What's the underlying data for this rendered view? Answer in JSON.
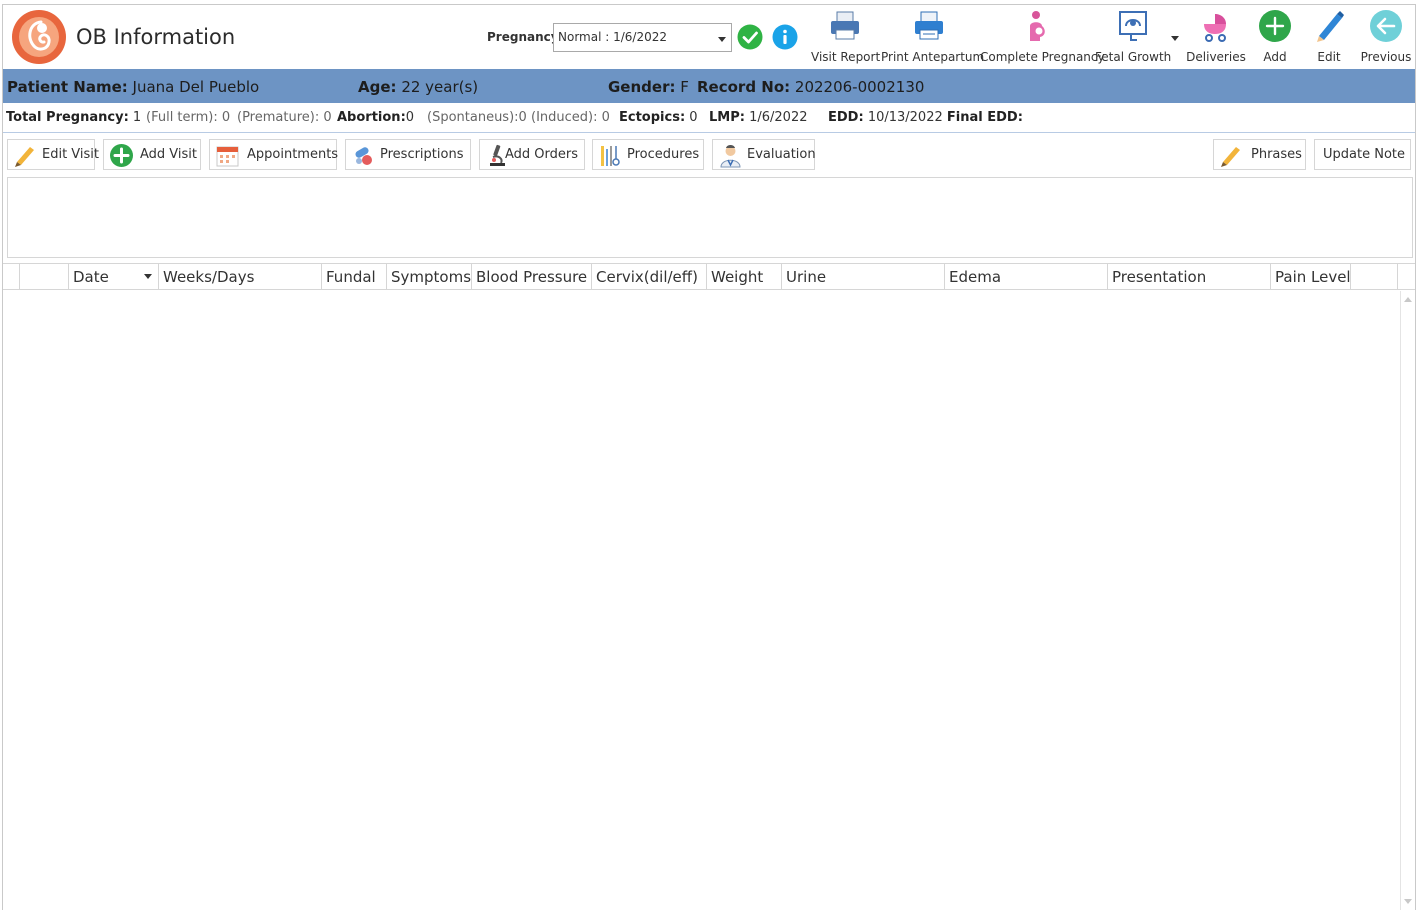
{
  "app": {
    "title": "OB Information",
    "logo_icon": "fetus-logo-icon"
  },
  "pregnancy": {
    "label": "Pregnancy:",
    "selected": "Normal : 1/6/2022"
  },
  "toolbar": {
    "visit_report": "Visit Report",
    "print_antepartum": "Print Antepartum",
    "complete_pregnancy": "Complete Pregnancy",
    "fetal_growth": "Fetal Growth",
    "deliveries": "Deliveries",
    "add": "Add",
    "edit": "Edit",
    "previous": "Previous"
  },
  "patient": {
    "name_label": "Patient Name:",
    "name": "Juana Del Pueblo",
    "age_label": "Age:",
    "age": "22 year(s)",
    "gender_label": "Gender:",
    "gender": "F",
    "record_label": "Record No:",
    "record": "202206-0002130"
  },
  "summary": {
    "total_label": "Total Pregnancy:",
    "total": "1",
    "fullterm_label": "(Full term):",
    "fullterm": "0",
    "premature_label": "(Premature):",
    "premature": "0",
    "abortion_label": "Abortion:",
    "abortion": "0",
    "spontaneus_label": "(Spontaneus):",
    "spontaneus": "0",
    "induced_label": "(Induced):",
    "induced": "0",
    "ectopics_label": "Ectopics:",
    "ectopics": "0",
    "lmp_label": "LMP:",
    "lmp": "1/6/2022",
    "edd_label": "EDD:",
    "edd": "10/13/2022",
    "final_edd_label": "Final EDD:"
  },
  "actions": {
    "edit_visit": "Edit Visit",
    "add_visit": "Add Visit",
    "appointments": "Appointments",
    "prescriptions": "Prescriptions",
    "add_orders": "Add Orders",
    "procedures": "Procedures",
    "evaluation": "Evaluation",
    "phrases": "Phrases",
    "update_note": "Update Note"
  },
  "grid": {
    "columns": [
      "Date",
      "Weeks/Days",
      "Fundal",
      "Symptoms",
      "Blood Pressure",
      "Cervix(dil/eff)",
      "Weight",
      "Urine",
      "Edema",
      "Presentation",
      "Pain Level"
    ]
  },
  "colors": {
    "patient_bar": "#6d94c4",
    "accent_green": "#2fb344",
    "accent_blue": "#1aa3e8"
  }
}
